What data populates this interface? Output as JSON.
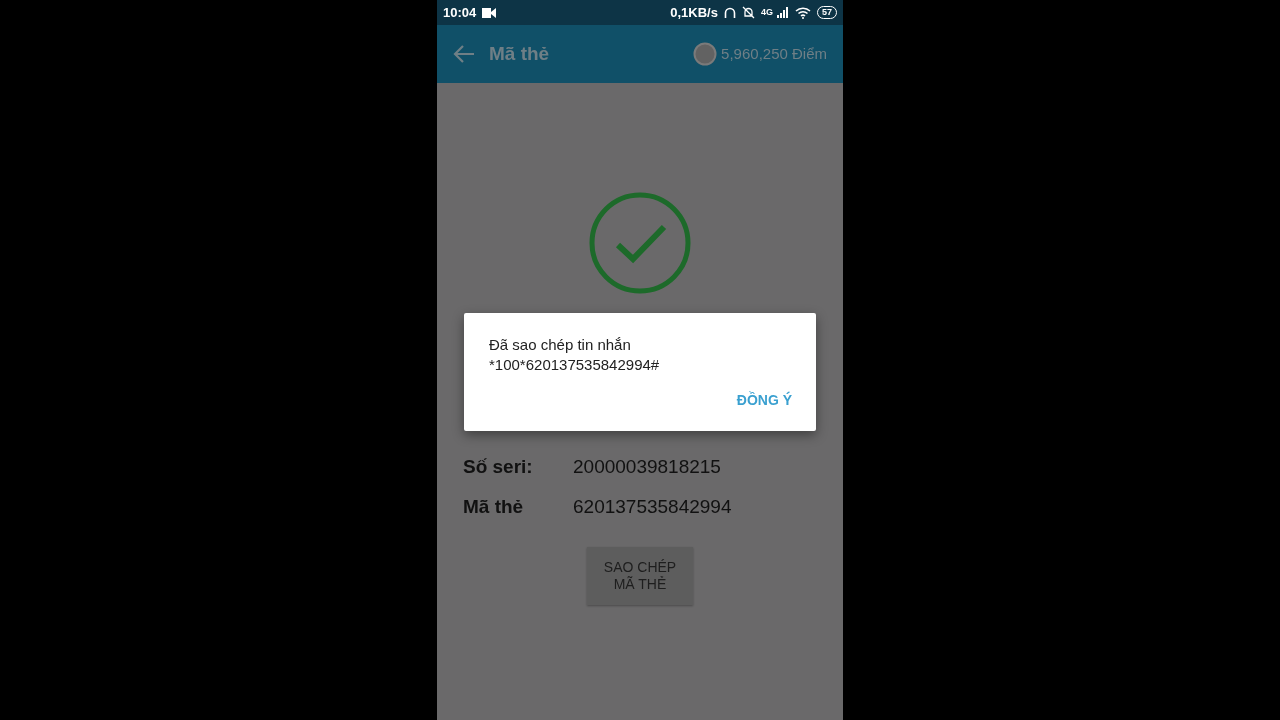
{
  "status_bar": {
    "time": "10:04",
    "network_speed": "0,1KB/s",
    "network_type": "4G",
    "battery": "57"
  },
  "app_bar": {
    "title": "Mã thẻ",
    "points": "5,960,250 Điểm"
  },
  "details": [
    {
      "label": "Số seri:",
      "value": "20000039818215"
    },
    {
      "label": "Mã thẻ",
      "value": "620137535842994"
    }
  ],
  "copy_button": "SAO CHÉP MÃ THẺ",
  "dialog": {
    "message": "Đã sao chép tin nhắn\n*100*620137535842994#",
    "button": "ĐỒNG Ý"
  }
}
